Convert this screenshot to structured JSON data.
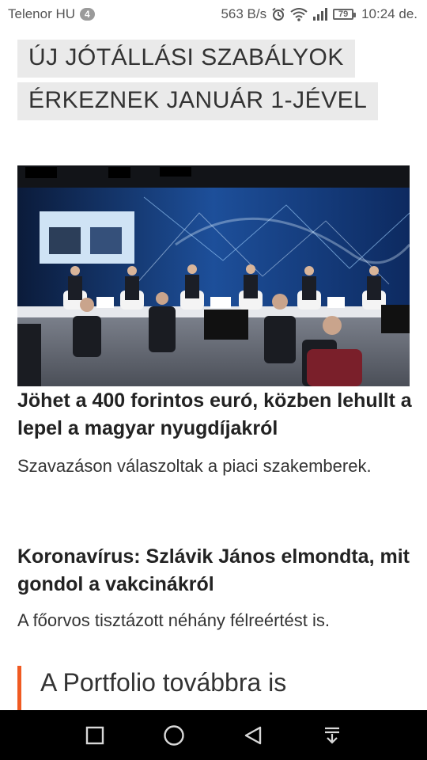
{
  "status_bar": {
    "carrier": "Telenor HU",
    "notification_count": "4",
    "speed": "563 B/s",
    "battery": "79",
    "time": "10:24 de."
  },
  "headline": {
    "line1": "ÚJ JÓTÁLLÁSI SZABÁLYOK",
    "line2": "ÉRKEZNEK JANUÁR 1-JÉVEL"
  },
  "article1": {
    "title": "Jöhet a 400 forintos euró, közben lehullt a lepel a magyar nyugdíjakról",
    "lead": "Szavazáson válaszoltak a piaci szakemberek."
  },
  "article2": {
    "title": "Koronavírus: Szlávik János elmondta, mit gondol a vakcinákról",
    "lead": "A főorvos tisztázott néhány félreértést is."
  },
  "more": {
    "text": "A Portfolio továbbra is"
  },
  "colors": {
    "accent": "#f05a22",
    "headline_bg": "#eaeaea",
    "nav_bg": "#000000"
  },
  "icons": {
    "alarm": "alarm-icon",
    "wifi": "wifi-icon",
    "signal": "signal-icon",
    "battery": "battery-icon",
    "nav_recent": "square-icon",
    "nav_home": "circle-icon",
    "nav_back": "triangle-back-icon",
    "nav_notifications": "pull-down-icon"
  }
}
